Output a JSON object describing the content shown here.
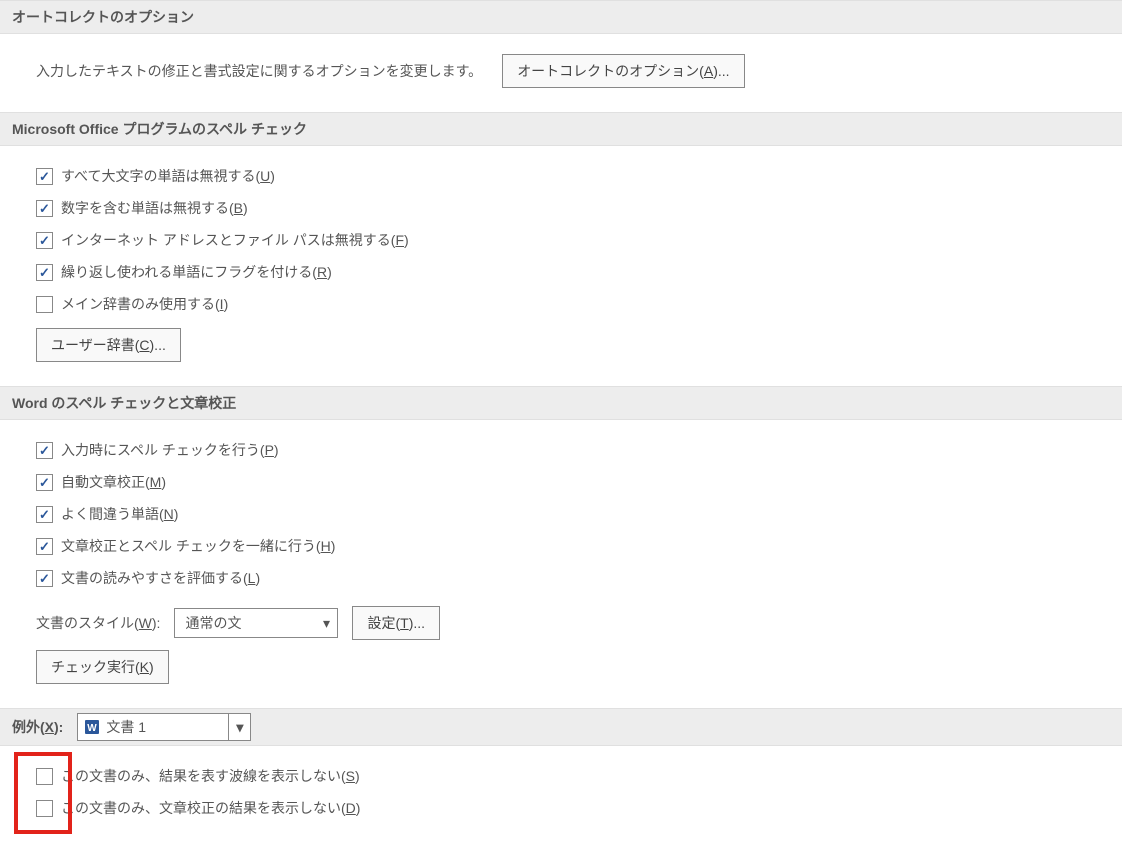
{
  "section1": {
    "title": "オートコレクトのオプション",
    "desc": "入力したテキストの修正と書式設定に関するオプションを変更します。",
    "btn": "オートコレクトのオプション(",
    "btn_key": "A",
    "btn_after": ")..."
  },
  "section2": {
    "title": "Microsoft Office プログラムのスペル チェック",
    "items": [
      {
        "checked": true,
        "pre": "すべて大文字の単語は無視する(",
        "key": "U",
        "post": ")"
      },
      {
        "checked": true,
        "pre": "数字を含む単語は無視する(",
        "key": "B",
        "post": ")"
      },
      {
        "checked": true,
        "pre": "インターネット アドレスとファイル パスは無視する(",
        "key": "F",
        "post": ")"
      },
      {
        "checked": true,
        "pre": "繰り返し使われる単語にフラグを付ける(",
        "key": "R",
        "post": ")"
      },
      {
        "checked": false,
        "pre": "メイン辞書のみ使用する(",
        "key": "I",
        "post": ")"
      }
    ],
    "btn": "ユーザー辞書(",
    "btn_key": "C",
    "btn_after": ")..."
  },
  "section3": {
    "title": "Word のスペル チェックと文章校正",
    "items": [
      {
        "checked": true,
        "pre": "入力時にスペル チェックを行う(",
        "key": "P",
        "post": ")"
      },
      {
        "checked": true,
        "pre": "自動文章校正(",
        "key": "M",
        "post": ")"
      },
      {
        "checked": true,
        "pre": "よく間違う単語(",
        "key": "N",
        "post": ")"
      },
      {
        "checked": true,
        "pre": "文章校正とスペル チェックを一緒に行う(",
        "key": "H",
        "post": ")"
      },
      {
        "checked": true,
        "pre": "文書の読みやすさを評価する(",
        "key": "L",
        "post": ")"
      }
    ],
    "style_label_pre": "文書のスタイル(",
    "style_label_key": "W",
    "style_label_post": "):",
    "style_value": "通常の文",
    "settings_btn_pre": "設定(",
    "settings_btn_key": "T",
    "settings_btn_post": ")...",
    "recheck_btn_pre": "チェック実行(",
    "recheck_btn_key": "K",
    "recheck_btn_post": ")"
  },
  "section4": {
    "title_pre": "例外(",
    "title_key": "X",
    "title_post": "):",
    "doc_value": "文書 1",
    "items": [
      {
        "checked": false,
        "pre": "この文書のみ、結果を表す波線を表示しない(",
        "key": "S",
        "post": ")"
      },
      {
        "checked": false,
        "pre": "この文書のみ、文章校正の結果を表示しない(",
        "key": "D",
        "post": ")"
      }
    ]
  }
}
